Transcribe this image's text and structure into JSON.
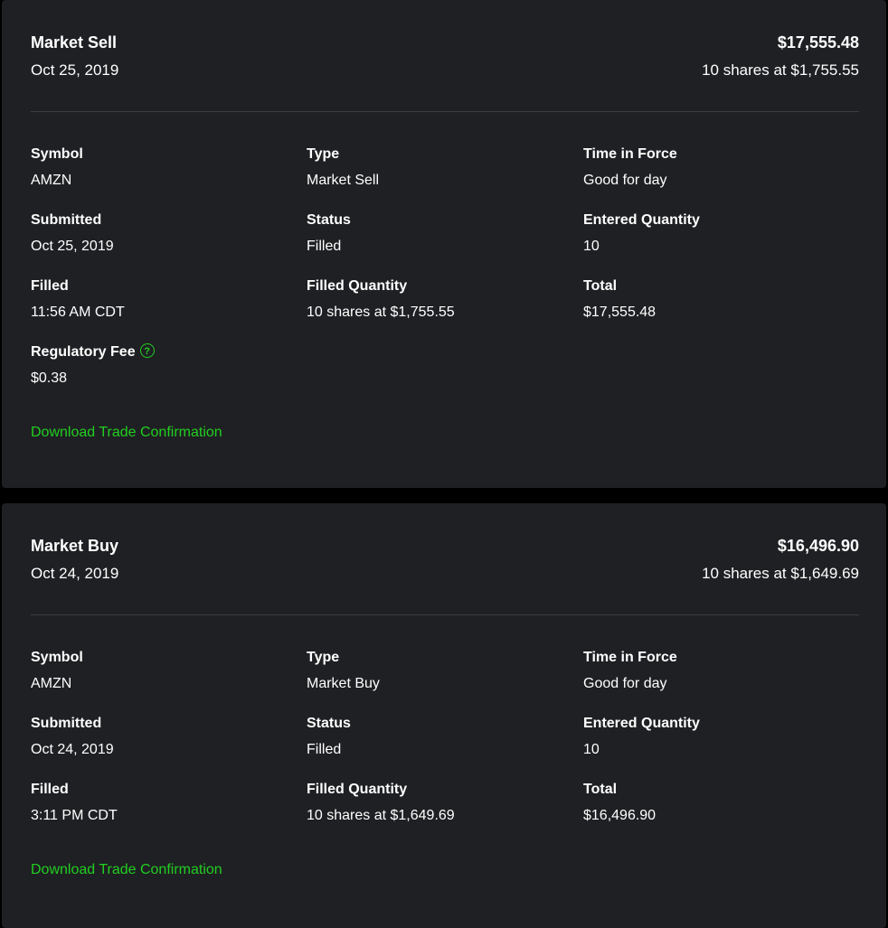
{
  "colors": {
    "background": "#000000",
    "card": "#1f2023",
    "text": "#ffffff",
    "divider": "#3b3d42",
    "accent_green": "#21ce21"
  },
  "orders": [
    {
      "title": "Market Sell",
      "date": "Oct 25, 2019",
      "amount": "$17,555.48",
      "summary": "10 shares at $1,755.55",
      "fields": {
        "symbol": {
          "label": "Symbol",
          "value": "AMZN"
        },
        "type": {
          "label": "Type",
          "value": "Market Sell"
        },
        "time_in_force": {
          "label": "Time in Force",
          "value": "Good for day"
        },
        "submitted": {
          "label": "Submitted",
          "value": "Oct 25, 2019"
        },
        "status": {
          "label": "Status",
          "value": "Filled"
        },
        "entered_quantity": {
          "label": "Entered Quantity",
          "value": "10"
        },
        "filled": {
          "label": "Filled",
          "value": "11:56 AM CDT"
        },
        "filled_quantity": {
          "label": "Filled Quantity",
          "value": "10 shares at $1,755.55"
        },
        "total": {
          "label": "Total",
          "value": "$17,555.48"
        },
        "regulatory_fee": {
          "label": "Regulatory Fee",
          "value": "$0.38",
          "icon": "help-icon",
          "icon_glyph": "?"
        }
      },
      "download_label": "Download Trade Confirmation"
    },
    {
      "title": "Market Buy",
      "date": "Oct 24, 2019",
      "amount": "$16,496.90",
      "summary": "10 shares at $1,649.69",
      "fields": {
        "symbol": {
          "label": "Symbol",
          "value": "AMZN"
        },
        "type": {
          "label": "Type",
          "value": "Market Buy"
        },
        "time_in_force": {
          "label": "Time in Force",
          "value": "Good for day"
        },
        "submitted": {
          "label": "Submitted",
          "value": "Oct 24, 2019"
        },
        "status": {
          "label": "Status",
          "value": "Filled"
        },
        "entered_quantity": {
          "label": "Entered Quantity",
          "value": "10"
        },
        "filled": {
          "label": "Filled",
          "value": "3:11 PM CDT"
        },
        "filled_quantity": {
          "label": "Filled Quantity",
          "value": "10 shares at $1,649.69"
        },
        "total": {
          "label": "Total",
          "value": "$16,496.90"
        }
      },
      "download_label": "Download Trade Confirmation"
    }
  ]
}
